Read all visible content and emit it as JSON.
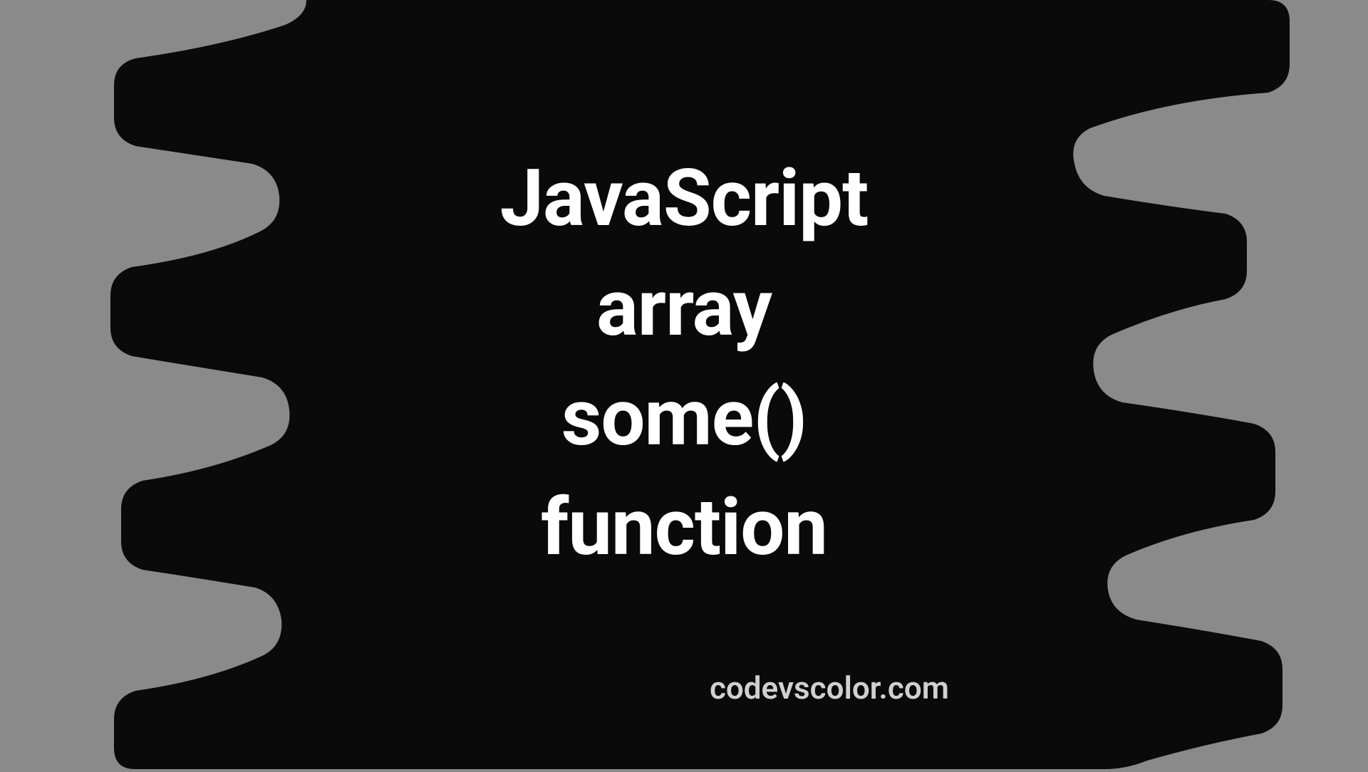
{
  "title": {
    "line1": "JavaScript",
    "line2": "array",
    "line3": "some()",
    "line4": "function"
  },
  "footer": "codevscolor.com",
  "colors": {
    "background": "#8a8a8a",
    "blob": "#0a0a0a",
    "text": "#ffffff",
    "footer": "#d0d0d0"
  }
}
